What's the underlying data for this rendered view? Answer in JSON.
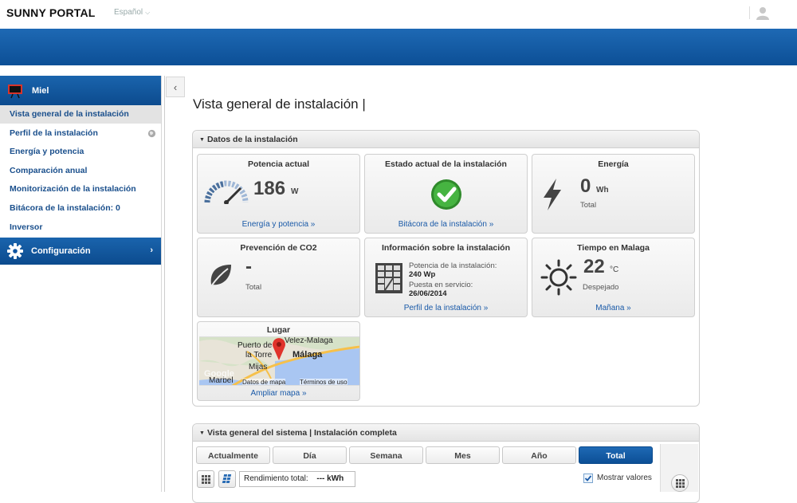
{
  "app": {
    "brand": "SUNNY PORTAL",
    "language": "Español"
  },
  "sidebar": {
    "plant_name": "Miel",
    "items": [
      {
        "label": "Vista general de la instalación",
        "active": true
      },
      {
        "label": "Perfil de la instalación",
        "active": false
      },
      {
        "label": "Energía y potencia",
        "active": false
      },
      {
        "label": "Comparación anual",
        "active": false
      },
      {
        "label": "Monitorización de la instalación",
        "active": false
      },
      {
        "label": "Bitácora de la instalación: 0",
        "active": false
      },
      {
        "label": "Inversor",
        "active": false
      }
    ],
    "config_label": "Configuración"
  },
  "page": {
    "title": "Vista general de instalación |"
  },
  "plant_data": {
    "header": "Datos de la instalación",
    "power": {
      "title": "Potencia actual",
      "value": "186",
      "unit": "W",
      "link": "Energía y potencia »"
    },
    "status": {
      "title": "Estado actual de la instalación",
      "link": "Bitácora de la instalación »"
    },
    "energy": {
      "title": "Energía",
      "value": "0",
      "unit": "Wh",
      "caption": "Total"
    },
    "co2": {
      "title": "Prevención de CO2",
      "value": "-",
      "caption": "Total"
    },
    "info": {
      "title": "Información sobre la instalación",
      "power_label": "Potencia de la instalación:",
      "power_value": "240 Wp",
      "commission_label": "Puesta en servicio:",
      "commission_value": "26/06/2014",
      "link": "Perfil de la instalación »"
    },
    "weather": {
      "title": "Tiempo en Malaga",
      "value": "22",
      "unit": "°C",
      "caption": "Despejado",
      "link": "Mañana »"
    },
    "location": {
      "title": "Lugar",
      "link": "Ampliar mapa »",
      "map_labels": {
        "velez": "Velez-Malaga",
        "puerto": "Puerto de",
        "torre": "la Torre",
        "malaga": "Málaga",
        "mijas": "Mijas",
        "marbella": "Marbel",
        "google": "Google",
        "data": "Datos de mapa",
        "terms": "Términos de uso"
      }
    }
  },
  "system_overview": {
    "header": "Vista general del sistema | Instalación completa",
    "tabs": [
      {
        "label": "Actualmente",
        "selected": false
      },
      {
        "label": "Día",
        "selected": false
      },
      {
        "label": "Semana",
        "selected": false
      },
      {
        "label": "Mes",
        "selected": false
      },
      {
        "label": "Año",
        "selected": false
      },
      {
        "label": "Total",
        "selected": true
      }
    ],
    "yield_label": "Rendimiento total:",
    "yield_value": "--- kWh",
    "show_values_label": "Mostrar valores",
    "show_values_checked": true
  },
  "colors": {
    "brand_blue": "#0c4f96",
    "link_blue": "#1a5aa8",
    "status_green": "#3aa335"
  }
}
